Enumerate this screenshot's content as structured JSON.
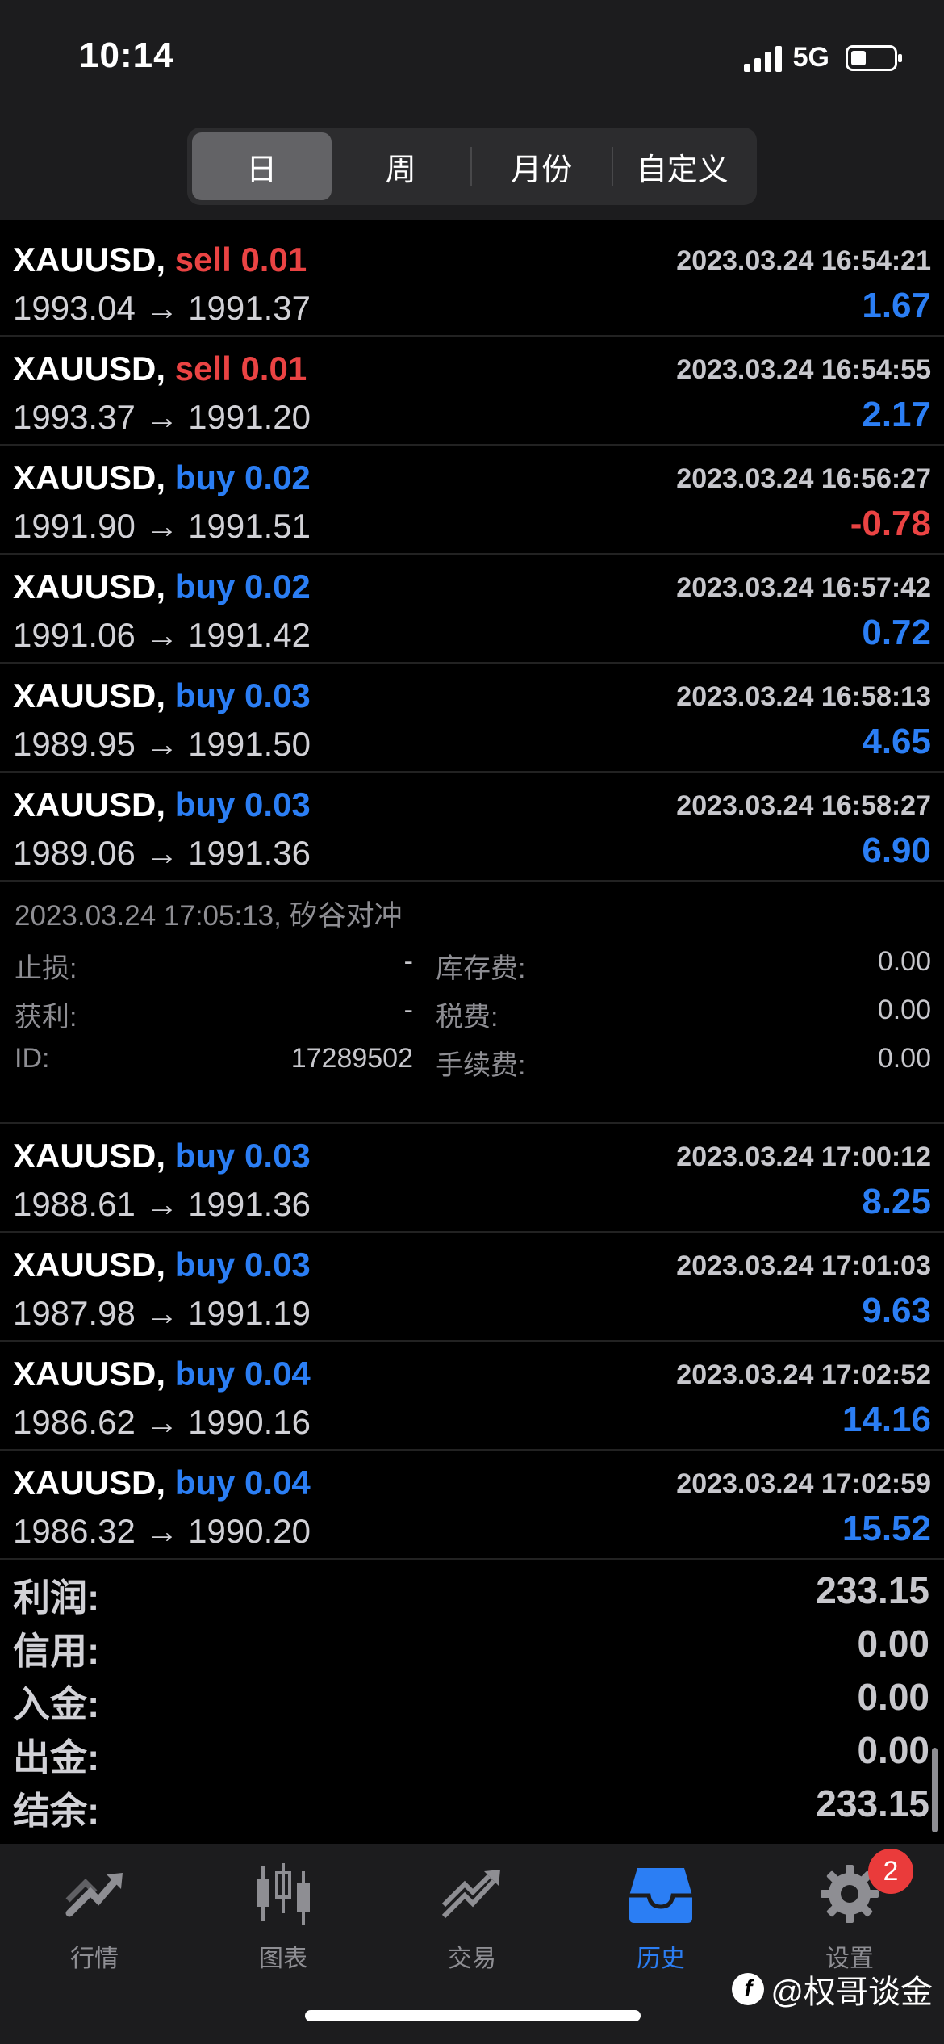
{
  "status": {
    "time": "10:14",
    "network": "5G"
  },
  "segments": [
    "日",
    "周",
    "月份",
    "自定义"
  ],
  "trades_top": [
    {
      "symbol": "XAUUSD,",
      "side": "sell",
      "lots": "0.01",
      "datetime": "2023.03.24 16:54:21",
      "prices": "1993.04 → 1991.37",
      "profit": "1.67"
    },
    {
      "symbol": "XAUUSD,",
      "side": "sell",
      "lots": "0.01",
      "datetime": "2023.03.24 16:54:55",
      "prices": "1993.37 → 1991.20",
      "profit": "2.17"
    },
    {
      "symbol": "XAUUSD,",
      "side": "buy",
      "lots": "0.02",
      "datetime": "2023.03.24 16:56:27",
      "prices": "1991.90 → 1991.51",
      "profit": "-0.78"
    },
    {
      "symbol": "XAUUSD,",
      "side": "buy",
      "lots": "0.02",
      "datetime": "2023.03.24 16:57:42",
      "prices": "1991.06 → 1991.42",
      "profit": "0.72"
    },
    {
      "symbol": "XAUUSD,",
      "side": "buy",
      "lots": "0.03",
      "datetime": "2023.03.24 16:58:13",
      "prices": "1989.95 → 1991.50",
      "profit": "4.65"
    },
    {
      "symbol": "XAUUSD,",
      "side": "buy",
      "lots": "0.03",
      "datetime": "2023.03.24 16:58:27",
      "prices": "1989.06 → 1991.36",
      "profit": "6.90"
    }
  ],
  "detail": {
    "header": "2023.03.24 17:05:13, 矽谷对冲",
    "sl_label": "止损:",
    "sl_value": "-",
    "tp_label": "获利:",
    "tp_value": "-",
    "id_label": "ID:",
    "id_value": "17289502",
    "swap_label": "库存费:",
    "swap_value": "0.00",
    "tax_label": "税费:",
    "tax_value": "0.00",
    "fee_label": "手续费:",
    "fee_value": "0.00"
  },
  "trades_bottom": [
    {
      "symbol": "XAUUSD,",
      "side": "buy",
      "lots": "0.03",
      "datetime": "2023.03.24 17:00:12",
      "prices": "1988.61 → 1991.36",
      "profit": "8.25"
    },
    {
      "symbol": "XAUUSD,",
      "side": "buy",
      "lots": "0.03",
      "datetime": "2023.03.24 17:01:03",
      "prices": "1987.98 → 1991.19",
      "profit": "9.63"
    },
    {
      "symbol": "XAUUSD,",
      "side": "buy",
      "lots": "0.04",
      "datetime": "2023.03.24 17:02:52",
      "prices": "1986.62 → 1990.16",
      "profit": "14.16"
    },
    {
      "symbol": "XAUUSD,",
      "side": "buy",
      "lots": "0.04",
      "datetime": "2023.03.24 17:02:59",
      "prices": "1986.32 → 1990.20",
      "profit": "15.52"
    }
  ],
  "summary": [
    {
      "label": "利润:",
      "value": "233.15"
    },
    {
      "label": "信用:",
      "value": "0.00"
    },
    {
      "label": "入金:",
      "value": "0.00"
    },
    {
      "label": "出金:",
      "value": "0.00"
    },
    {
      "label": "结余:",
      "value": "233.15"
    }
  ],
  "tabs": [
    {
      "label": "行情",
      "icon": "quotes-icon"
    },
    {
      "label": "图表",
      "icon": "chart-icon"
    },
    {
      "label": "交易",
      "icon": "trade-icon"
    },
    {
      "label": "历史",
      "icon": "history-icon",
      "active": true
    },
    {
      "label": "设置",
      "icon": "settings-icon"
    }
  ],
  "badge": "2",
  "watermark": "@权哥谈金",
  "colors": {
    "sell": "#ea4343",
    "buy": "#2b7ef4",
    "background": "#000000",
    "bar": "#1c1c1e"
  }
}
